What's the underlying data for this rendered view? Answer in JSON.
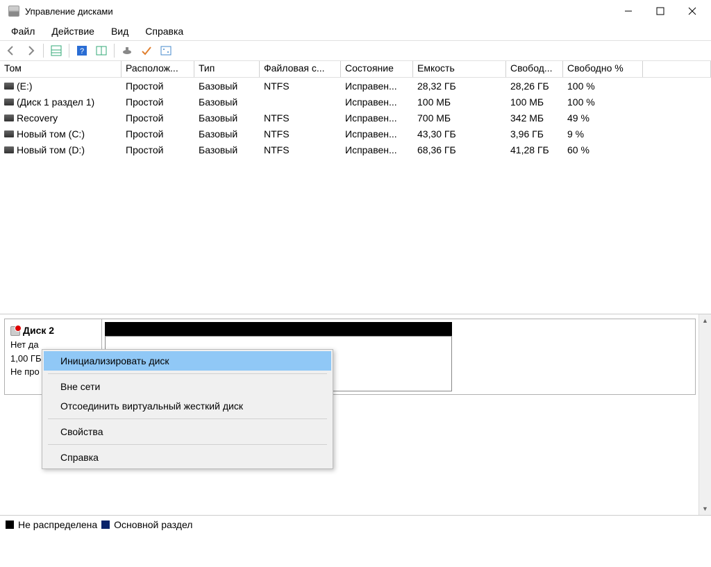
{
  "window": {
    "title": "Управление дисками"
  },
  "menu": {
    "file": "Файл",
    "action": "Действие",
    "view": "Вид",
    "help": "Справка"
  },
  "columns": {
    "volume": "Том",
    "layout": "Располож...",
    "type": "Тип",
    "fs": "Файловая с...",
    "status": "Состояние",
    "capacity": "Емкость",
    "free": "Свобод...",
    "freep": "Свободно %"
  },
  "volumes": [
    {
      "name": " (E:)",
      "layout": "Простой",
      "type": "Базовый",
      "fs": "NTFS",
      "status": "Исправен...",
      "capacity": "28,32 ГБ",
      "free": "28,26 ГБ",
      "freep": "100 %"
    },
    {
      "name": " (Диск 1 раздел 1)",
      "layout": "Простой",
      "type": "Базовый",
      "fs": "",
      "status": "Исправен...",
      "capacity": "100 МБ",
      "free": "100 МБ",
      "freep": "100 %"
    },
    {
      "name": "Recovery",
      "layout": "Простой",
      "type": "Базовый",
      "fs": "NTFS",
      "status": "Исправен...",
      "capacity": "700 МБ",
      "free": "342 МБ",
      "freep": "49 %"
    },
    {
      "name": "Новый том (C:)",
      "layout": "Простой",
      "type": "Базовый",
      "fs": "NTFS",
      "status": "Исправен...",
      "capacity": "43,30 ГБ",
      "free": "3,96 ГБ",
      "freep": "9 %"
    },
    {
      "name": "Новый том (D:)",
      "layout": "Простой",
      "type": "Базовый",
      "fs": "NTFS",
      "status": "Исправен...",
      "capacity": "68,36 ГБ",
      "free": "41,28 ГБ",
      "freep": "60 %"
    }
  ],
  "disk": {
    "name": "Диск 2",
    "line1": "Нет да",
    "line2": "1,00 ГБ",
    "line3": "Не про"
  },
  "context": {
    "initialize": "Инициализировать диск",
    "offline": "Вне сети",
    "detach": "Отсоединить виртуальный жесткий диск",
    "properties": "Свойства",
    "help": "Справка"
  },
  "legend": {
    "unallocated": "Не распределена",
    "primary": "Основной раздел"
  }
}
